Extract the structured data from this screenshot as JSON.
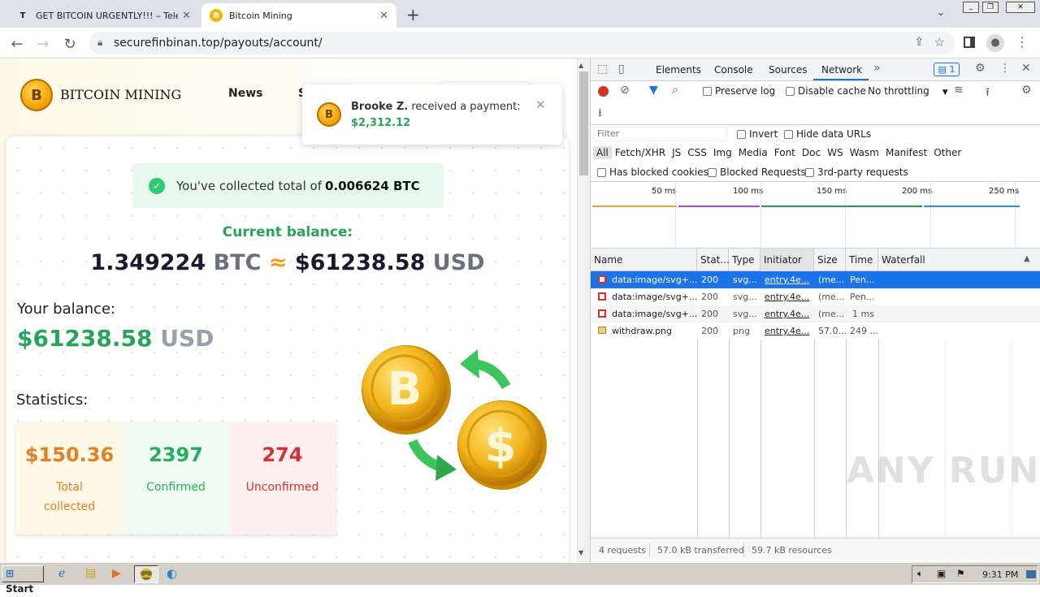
{
  "tabs": [
    {
      "title": "GET BITCOIN URGENTLY!!! – Telegra",
      "fav": "T"
    },
    {
      "title": "Bitcoin Mining",
      "fav": "B"
    }
  ],
  "address": {
    "url": "securefinbinan.top/payouts/account/"
  },
  "site": {
    "brand": "BITCOIN MINING",
    "nav": [
      "News",
      "S"
    ],
    "notification": {
      "name": "Brooke Z.",
      "text": " received a payment:",
      "amount": "$2,312.12"
    },
    "collected_prefix": "You've collected total of ",
    "collected_value": "0.006624 BTC",
    "current_balance_label": "Current balance:",
    "btc_amount": "1.349224",
    "btc_unit": "BTC",
    "approx": "≈",
    "usd_amount": "$61238.58",
    "usd_unit": "USD",
    "your_balance_label": "Your balance:",
    "your_balance_value": "$61238.58",
    "your_balance_unit": "USD",
    "statistics_label": "Statistics:",
    "stats": [
      {
        "value": "$150.36",
        "label1": "Total",
        "label2": "collected",
        "color": "#e67e22",
        "bg": "#fff8e6"
      },
      {
        "value": "2397",
        "label1": "Confirmed",
        "label2": "",
        "color": "#27ae60",
        "bg": "#eefaf2"
      },
      {
        "value": "274",
        "label1": "Unconfirmed",
        "label2": "",
        "color": "#d63030",
        "bg": "#fdf0ef"
      }
    ],
    "coin_b": "B",
    "coin_dollar": "$"
  },
  "devtools": {
    "tabs": [
      "Elements",
      "Console",
      "Sources",
      "Network"
    ],
    "active_tab": "Network",
    "issues_count": "1",
    "preserve_log": "Preserve log",
    "disable_cache": "Disable cache",
    "throttling": "No throttling",
    "filter_placeholder": "Filter",
    "invert": "Invert",
    "hide_data_urls": "Hide data URLs",
    "types": [
      "All",
      "Fetch/XHR",
      "JS",
      "CSS",
      "Img",
      "Media",
      "Font",
      "Doc",
      "WS",
      "Wasm",
      "Manifest",
      "Other"
    ],
    "has_blocked_cookies": "Has blocked cookies",
    "blocked_requests": "Blocked Requests",
    "third_party": "3rd-party requests",
    "timeline_ticks": [
      "50 ms",
      "100 ms",
      "150 ms",
      "200 ms",
      "250 ms"
    ],
    "columns": [
      "Name",
      "Stat...",
      "Type",
      "Initiator",
      "Size",
      "Time",
      "Waterfall"
    ],
    "rows": [
      {
        "name": "data:image/svg+...",
        "status": "200",
        "type": "svg...",
        "initiator": "entry.4e...",
        "size": "(me...",
        "time": "Pen..."
      },
      {
        "name": "data:image/svg+...",
        "status": "200",
        "type": "svg...",
        "initiator": "entry.4e...",
        "size": "(me...",
        "time": "Pen..."
      },
      {
        "name": "data:image/svg+...",
        "status": "200",
        "type": "svg...",
        "initiator": "entry.4e...",
        "size": "(me...",
        "time": "1 ms"
      },
      {
        "name": "withdraw.png",
        "status": "200",
        "type": "png",
        "initiator": "entry.4e...",
        "size": "57.0...",
        "time": "249 ..."
      }
    ],
    "status_bar": [
      "4 requests",
      "57.0 kB transferred",
      "59.7 kB resources"
    ]
  },
  "watermark": "ANY RUN",
  "taskbar": {
    "start": "Start",
    "time": "9:31 PM"
  }
}
